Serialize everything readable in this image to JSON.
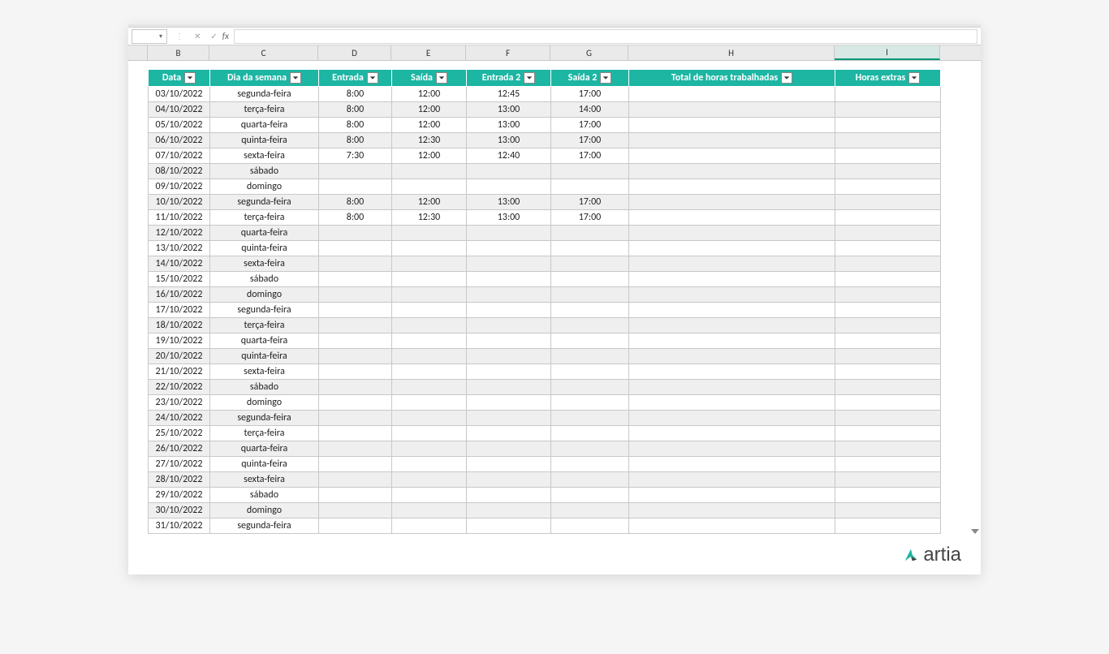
{
  "formula_bar": {
    "name_box": "",
    "cancel_icon": "✕",
    "confirm_icon": "✓",
    "fx_label": "fx",
    "formula_value": ""
  },
  "column_letters": [
    "B",
    "C",
    "D",
    "E",
    "F",
    "G",
    "H",
    "I"
  ],
  "column_widths_class": [
    "col-B",
    "col-C",
    "col-D",
    "col-E",
    "col-F",
    "col-G",
    "col-H",
    "col-I"
  ],
  "selected_column_index": 7,
  "table": {
    "headers": [
      "Data",
      "Dia da semana",
      "Entrada",
      "Saída",
      "Entrada 2",
      "Saída 2",
      "Total de horas trabalhadas",
      "Horas extras"
    ],
    "rows": [
      {
        "alt": false,
        "cells": [
          "03/10/2022",
          "segunda-feira",
          "8:00",
          "12:00",
          "12:45",
          "17:00",
          "",
          ""
        ]
      },
      {
        "alt": true,
        "cells": [
          "04/10/2022",
          "terça-feira",
          "8:00",
          "12:00",
          "13:00",
          "14:00",
          "",
          ""
        ]
      },
      {
        "alt": false,
        "cells": [
          "05/10/2022",
          "quarta-feira",
          "8:00",
          "12:00",
          "13:00",
          "17:00",
          "",
          ""
        ]
      },
      {
        "alt": true,
        "cells": [
          "06/10/2022",
          "quinta-feira",
          "8:00",
          "12:30",
          "13:00",
          "17:00",
          "",
          ""
        ]
      },
      {
        "alt": false,
        "cells": [
          "07/10/2022",
          "sexta-feira",
          "7:30",
          "12:00",
          "12:40",
          "17:00",
          "",
          ""
        ]
      },
      {
        "alt": true,
        "cells": [
          "08/10/2022",
          "sábado",
          "",
          "",
          "",
          "",
          "",
          ""
        ]
      },
      {
        "alt": false,
        "cells": [
          "09/10/2022",
          "domingo",
          "",
          "",
          "",
          "",
          "",
          ""
        ]
      },
      {
        "alt": true,
        "cells": [
          "10/10/2022",
          "segunda-feira",
          "8:00",
          "12:00",
          "13:00",
          "17:00",
          "",
          ""
        ]
      },
      {
        "alt": false,
        "cells": [
          "11/10/2022",
          "terça-feira",
          "8:00",
          "12:30",
          "13:00",
          "17:00",
          "",
          ""
        ]
      },
      {
        "alt": true,
        "cells": [
          "12/10/2022",
          "quarta-feira",
          "",
          "",
          "",
          "",
          "",
          ""
        ]
      },
      {
        "alt": false,
        "cells": [
          "13/10/2022",
          "quinta-feira",
          "",
          "",
          "",
          "",
          "",
          ""
        ]
      },
      {
        "alt": true,
        "cells": [
          "14/10/2022",
          "sexta-feira",
          "",
          "",
          "",
          "",
          "",
          ""
        ]
      },
      {
        "alt": false,
        "cells": [
          "15/10/2022",
          "sábado",
          "",
          "",
          "",
          "",
          "",
          ""
        ]
      },
      {
        "alt": true,
        "cells": [
          "16/10/2022",
          "domingo",
          "",
          "",
          "",
          "",
          "",
          ""
        ]
      },
      {
        "alt": false,
        "cells": [
          "17/10/2022",
          "segunda-feira",
          "",
          "",
          "",
          "",
          "",
          ""
        ]
      },
      {
        "alt": true,
        "cells": [
          "18/10/2022",
          "terça-feira",
          "",
          "",
          "",
          "",
          "",
          ""
        ]
      },
      {
        "alt": false,
        "cells": [
          "19/10/2022",
          "quarta-feira",
          "",
          "",
          "",
          "",
          "",
          ""
        ]
      },
      {
        "alt": true,
        "cells": [
          "20/10/2022",
          "quinta-feira",
          "",
          "",
          "",
          "",
          "",
          ""
        ]
      },
      {
        "alt": false,
        "cells": [
          "21/10/2022",
          "sexta-feira",
          "",
          "",
          "",
          "",
          "",
          ""
        ]
      },
      {
        "alt": true,
        "cells": [
          "22/10/2022",
          "sábado",
          "",
          "",
          "",
          "",
          "",
          ""
        ]
      },
      {
        "alt": false,
        "cells": [
          "23/10/2022",
          "domingo",
          "",
          "",
          "",
          "",
          "",
          ""
        ]
      },
      {
        "alt": true,
        "cells": [
          "24/10/2022",
          "segunda-feira",
          "",
          "",
          "",
          "",
          "",
          ""
        ]
      },
      {
        "alt": false,
        "cells": [
          "25/10/2022",
          "terça-feira",
          "",
          "",
          "",
          "",
          "",
          ""
        ]
      },
      {
        "alt": true,
        "cells": [
          "26/10/2022",
          "quarta-feira",
          "",
          "",
          "",
          "",
          "",
          ""
        ]
      },
      {
        "alt": false,
        "cells": [
          "27/10/2022",
          "quinta-feira",
          "",
          "",
          "",
          "",
          "",
          ""
        ]
      },
      {
        "alt": true,
        "cells": [
          "28/10/2022",
          "sexta-feira",
          "",
          "",
          "",
          "",
          "",
          ""
        ]
      },
      {
        "alt": false,
        "cells": [
          "29/10/2022",
          "sábado",
          "",
          "",
          "",
          "",
          "",
          ""
        ]
      },
      {
        "alt": true,
        "cells": [
          "30/10/2022",
          "domingo",
          "",
          "",
          "",
          "",
          "",
          ""
        ]
      },
      {
        "alt": false,
        "cells": [
          "31/10/2022",
          "segunda-feira",
          "",
          "",
          "",
          "",
          "",
          ""
        ]
      }
    ]
  },
  "brand": {
    "name": "artia",
    "accent_color": "#1cb6a3"
  }
}
